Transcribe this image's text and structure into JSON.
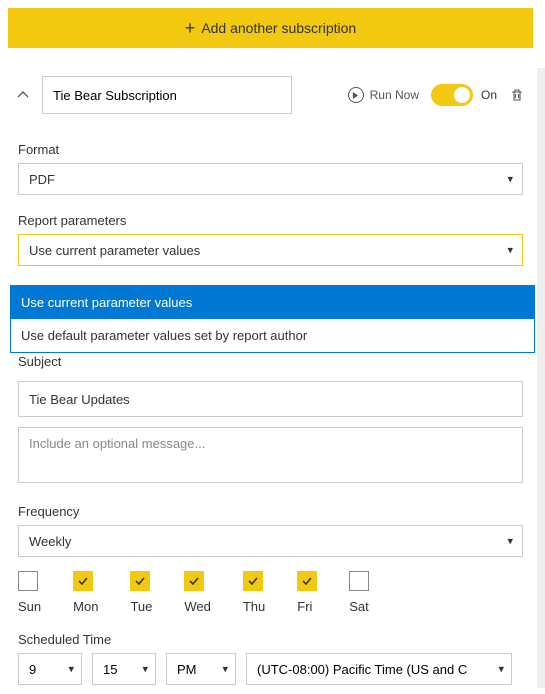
{
  "colors": {
    "accent": "#f2c811",
    "selected": "#0078d4"
  },
  "add_button": {
    "label": "Add another subscription"
  },
  "subscription": {
    "name": "Tie Bear Subscription",
    "run_now_label": "Run Now",
    "on_label": "On",
    "toggle_on": true
  },
  "format": {
    "label": "Format",
    "value": "PDF"
  },
  "report_params": {
    "label": "Report parameters",
    "value": "Use current parameter values",
    "options": [
      {
        "label": "Use current parameter values",
        "selected": true
      },
      {
        "label": "Use default parameter values set by report author",
        "selected": false
      }
    ]
  },
  "subject": {
    "label": "Subject",
    "value": "Tie Bear Updates"
  },
  "message": {
    "placeholder": "Include an optional message...",
    "value": ""
  },
  "frequency": {
    "label": "Frequency",
    "value": "Weekly"
  },
  "days": [
    {
      "label": "Sun",
      "checked": false
    },
    {
      "label": "Mon",
      "checked": true
    },
    {
      "label": "Tue",
      "checked": true
    },
    {
      "label": "Wed",
      "checked": true
    },
    {
      "label": "Thu",
      "checked": true
    },
    {
      "label": "Fri",
      "checked": true
    },
    {
      "label": "Sat",
      "checked": false
    }
  ],
  "scheduled_time": {
    "label": "Scheduled Time",
    "hour": "9",
    "minute": "15",
    "ampm": "PM",
    "timezone": "(UTC-08:00) Pacific Time (US and C"
  }
}
